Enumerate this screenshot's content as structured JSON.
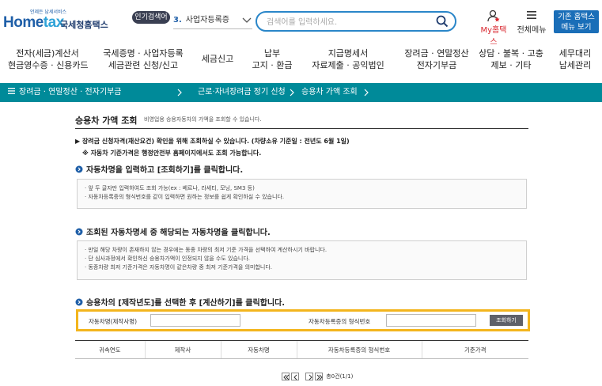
{
  "header": {
    "logo_tagline": "언제든 납세서비스",
    "logo_brand_a": "Home",
    "logo_brand_b": "tax",
    "logo_name": "국세청홈택스",
    "popular_label": "인기검색어",
    "popular_rank": "3.",
    "popular_keyword": "사업자등록증",
    "search_placeholder": "검색어를 입력하세요.",
    "myhome_label": "My홈택스",
    "allmenu_label": "전체메뉴",
    "basic_btn_line1": "기존 홈택스",
    "basic_btn_line2": "메뉴 보기"
  },
  "gnb": [
    {
      "l1": "전자(세금)계산서",
      "l2": "현금영수증 · 신용카드"
    },
    {
      "l1": "국세증명 · 사업자등록",
      "l2": "세금관련 신청/신고"
    },
    {
      "l1": "세금신고",
      "l2": ""
    },
    {
      "l1": "납부",
      "l2": "고지 · 환급"
    },
    {
      "l1": "지급명세서",
      "l2": "자료제출 · 공익법인"
    },
    {
      "l1": "장려금 · 연말정산",
      "l2": "전자기부금"
    },
    {
      "l1": "상담 · 불복 · 고충",
      "l2": "제보 · 기타"
    },
    {
      "l1": "세무대리",
      "l2": "납세관리"
    }
  ],
  "breadcrumb": [
    "장려금 · 연말정산 · 전자기부금",
    "근로·자녀장려금 정기 신청",
    "승용차 가액 조회"
  ],
  "page": {
    "title": "승용차 가액 조회",
    "subtitle": "비영업용 승용자동차의 가액을 조회할 수 있습니다.",
    "note1": "▶ 장려금 신청자격(재산요건) 확인을 위해 조회하실 수 있습니다. (차량소유 기준일 : 전년도 6월 1일)",
    "note2": "※ 자동차 기준가격은 행정안전부 홈페이지에서도 조회 가능합니다.",
    "step1": "자동차명을 입력하고 [조회하기]를 클릭합니다.",
    "step1_items": [
      "· 앞 두 글자만 입력하여도 조회 가능(ex : 베르나, 라세티, 모닝, SM3 등)",
      "· 자동차등록증의 형식번호를 같이 입력하면 원하는 정보를 쉽게 확인하실 수 있습니다."
    ],
    "step2": "조회된 자동차명세 중 해당되는 자동차명을 클릭합니다.",
    "step2_items": [
      "· 만일 해당 차량이 존재하지 않는 경우에는 동종 차량의 최저 기준 가격을 선택하여 계산하시기 바랍니다.",
      "· 단 심사과정에서 확인하신 승용차가액이 인정되지 않을 수도 있습니다.",
      "· 동종차량 최저 기준가격은 자동차명이 같은차량 중  최저 기준가격을 의미합니다."
    ],
    "step3": "승용차의 [제작년도]를 선택한 후 [계산하기]를 클릭합니다."
  },
  "form": {
    "car_name_label": "자동차명(제작사명)",
    "car_name_value": "",
    "type_no_label": "자동차등록증의 형식번호",
    "type_no_value": "",
    "search_btn": "조회하기"
  },
  "table": {
    "headers": [
      "귀속연도",
      "제작사",
      "자동차명",
      "자동차등록증의 형식번호",
      "기준가격"
    ]
  },
  "pager": {
    "summary": "총0건(1/1)"
  },
  "colors": {
    "brand_blue": "#1f5fa8",
    "accent_teal": "#008a99",
    "highlight_yellow": "#f3b51d",
    "myhome_red": "#d8262e"
  }
}
